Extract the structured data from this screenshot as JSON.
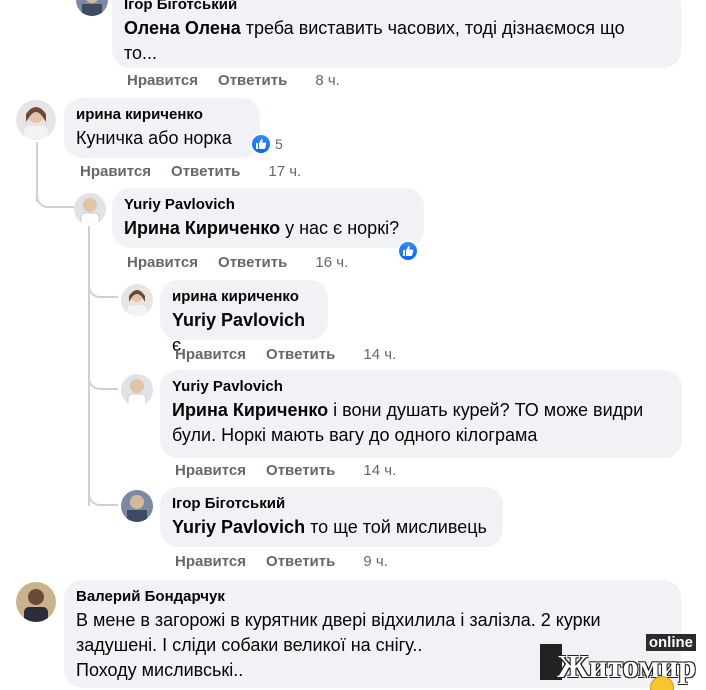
{
  "comments": [
    {
      "author": "Ігор Біготський",
      "mention": "Олена Олена",
      "text_line1": " треба виставить часових, тоді дізнаємося що",
      "text_line2": "то...",
      "like": "Нравится",
      "reply": "Ответить",
      "time": "8 ч."
    },
    {
      "author": "ирина кириченко",
      "text": "Куничка або норка",
      "like": "Нравится",
      "reply": "Ответить",
      "time": "17 ч.",
      "reactions": "5"
    },
    {
      "author": "Yuriy Pavlovich",
      "mention": "Ирина Кириченко",
      "text": " у нас є норкі?",
      "like": "Нравится",
      "reply": "Ответить",
      "time": "16 ч."
    },
    {
      "author": "ирина кириченко",
      "mention": "Yuriy Pavlovich",
      "text": " є",
      "like": "Нравится",
      "reply": "Ответить",
      "time": "14 ч."
    },
    {
      "author": "Yuriy Pavlovich",
      "mention": "Ирина Кириченко",
      "text_line1": " і вони душать курей? ТО може видри",
      "text_line2": "були. Норкі мають вагу до одного кілограма",
      "like": "Нравится",
      "reply": "Ответить",
      "time": "14 ч."
    },
    {
      "author": "Ігор Біготський",
      "mention": "Yuriy Pavlovich",
      "text": " то ще той мисливець",
      "like": "Нравится",
      "reply": "Ответить",
      "time": "9 ч."
    },
    {
      "author": "Валерий Бондарчук",
      "text_line1": "В мене в загорожі в курятник двері відхилила і залізла. 2 курки",
      "text_line2": "задушені. І сліди собаки великої на снігу..",
      "text_line3": "Походу мисливські.."
    }
  ],
  "watermark": {
    "main": "Житомир",
    "online": "online"
  },
  "colors": {
    "bubble": "#f0f2f5",
    "meta": "#65676b",
    "like_blue": "#0866ff",
    "thread": "#ced0d4"
  }
}
